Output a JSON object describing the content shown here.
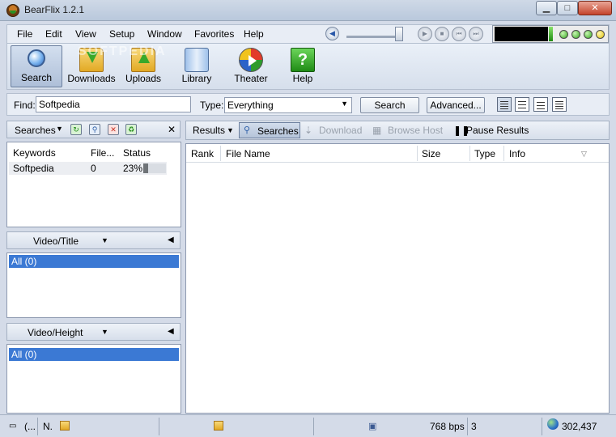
{
  "window": {
    "title": "BearFlix 1.2.1"
  },
  "menu": [
    "File",
    "Edit",
    "View",
    "Setup",
    "Window",
    "Favorites",
    "Help"
  ],
  "toolbar": {
    "search": "Search",
    "downloads": "Downloads",
    "uploads": "Uploads",
    "library": "Library",
    "theater": "Theater",
    "help": "Help",
    "watermark": "SOFTPEDIA"
  },
  "find": {
    "label": "Find:",
    "value": "Softpedia",
    "type_label": "Type:",
    "type_value": "Everything",
    "search_button": "Search",
    "advanced_button": "Advanced..."
  },
  "searches_panel": {
    "title": "Searches",
    "close": "✕",
    "columns": [
      "Keywords",
      "File...",
      "Status"
    ],
    "rows": [
      {
        "keyword": "Softpedia",
        "files": "0",
        "status": "23%",
        "progress": 0.23
      }
    ]
  },
  "filter_panels": [
    {
      "title": "Video/Title",
      "item": "All (0)"
    },
    {
      "title": "Video/Height",
      "item": "All (0)"
    }
  ],
  "results_bar": {
    "results": "Results",
    "searches": "Searches",
    "download": "Download",
    "browse_host": "Browse Host",
    "pause": "Pause Results"
  },
  "results_grid": {
    "columns": [
      "Rank",
      "File Name",
      "Size",
      "Type",
      "Info"
    ]
  },
  "status": {
    "cell1": "(...",
    "cell2": "N.",
    "bandwidth": "768 bps",
    "count": "3",
    "hosts": "302,437"
  }
}
